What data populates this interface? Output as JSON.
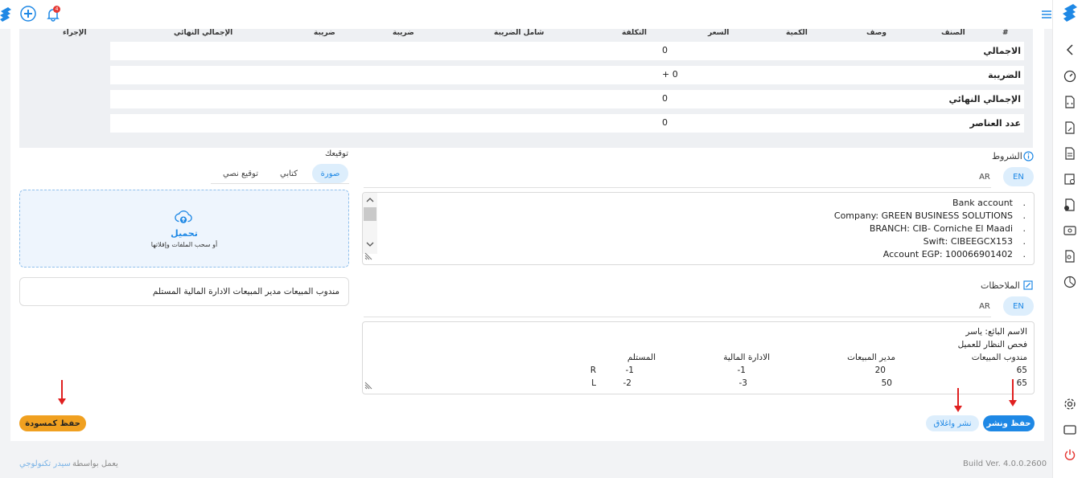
{
  "topbar": {
    "notification_count": "4"
  },
  "table": {
    "headers": [
      "#",
      "الصنف",
      "وصف",
      "الكمية",
      "السعر",
      "التكلفة",
      "شامل الضريبة",
      "ضريبة",
      "ضريبة",
      "الإجمالي النهائي",
      "الإجراء"
    ]
  },
  "summary": [
    {
      "label": "الاجمالي",
      "value": "0"
    },
    {
      "label": "الضريبة",
      "value": "+ 0"
    },
    {
      "label": "الإجمالي النهائي",
      "value": "0"
    },
    {
      "label": "عدد العناصر",
      "value": "0"
    }
  ],
  "terms": {
    "title": "الشروط",
    "tab_en": "EN",
    "tab_ar": "AR",
    "lines": [
      "Bank account",
      "Company: GREEN BUSINESS SOLUTIONS",
      "BRANCH: CIB- Corniche El Maadi",
      "Swift: CIBEEGCX153",
      "Account EGP: 100066901402"
    ]
  },
  "notes": {
    "title": "الملاحظات",
    "tab_en": "EN",
    "tab_ar": "AR",
    "line1": "الاسم البائع:  ياسر",
    "line2": "فحص النظار للعميل",
    "header_row": [
      "مندوب  المبيعات",
      "مدير المبيعات",
      "الادارة المالية",
      "المستلم"
    ],
    "row1": [
      "65",
      "20",
      "-1",
      "-1",
      "R"
    ],
    "row2": [
      "65",
      "50",
      "-3",
      "-2",
      "L"
    ]
  },
  "signature": {
    "title": "توقيعك",
    "tabs": [
      "صورة",
      "كتابي",
      "توقيع نصي"
    ],
    "upload_label": "تحميل",
    "upload_hint": "أو سحب الملفات وإفلاتها",
    "signers_text": "مندوب المبيعات مدير المبيعات الادارة المالية المستلم"
  },
  "buttons": {
    "save_publish": "حفظ ونشر",
    "publish_close": "نشر واغلاق",
    "save_draft": "حفظ كمسودة"
  },
  "footer": {
    "build": "Build Ver. 4.0.0.2600",
    "powered_by": "يعمل بواسطة",
    "company": "سيدر تكنولوجي"
  },
  "colors": {
    "primary": "#1e88e5",
    "draft": "#f0a020",
    "arrow": "#e02020"
  }
}
